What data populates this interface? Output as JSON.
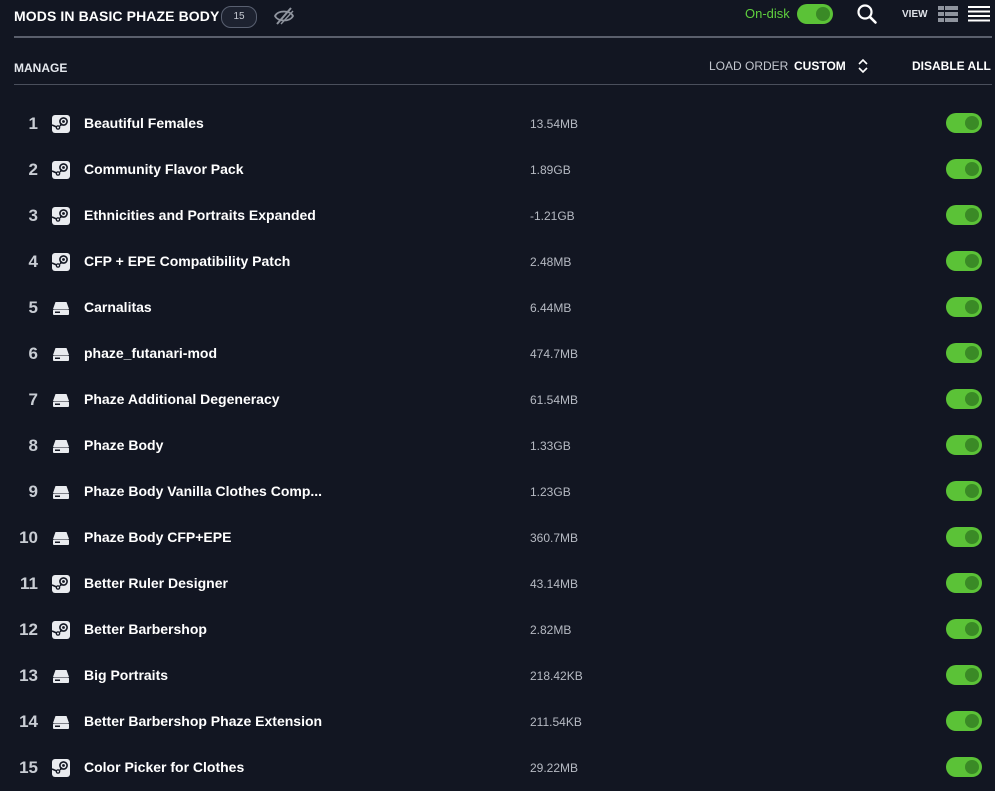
{
  "header": {
    "title": "MODS IN BASIC PHAZE BODY",
    "count": "15",
    "ondisk_label": "On-disk",
    "view_label": "VIEW"
  },
  "subheader": {
    "manage_label": "MANAGE",
    "load_order_label": "LOAD ORDER",
    "load_order_value": "CUSTOM",
    "disable_all_label": "DISABLE ALL"
  },
  "colors": {
    "background": "#121622",
    "toggle_on": "#5bc237",
    "ondisk_text": "#5fcf3e"
  },
  "mods": [
    {
      "num": "1",
      "name": "Beautiful Females",
      "size": "13.54MB",
      "source": "steam-icon",
      "enabled": true
    },
    {
      "num": "2",
      "name": "Community Flavor Pack",
      "size": "1.89GB",
      "source": "steam-icon",
      "enabled": true
    },
    {
      "num": "3",
      "name": "Ethnicities and Portraits Expanded",
      "size": "-1.21GB",
      "source": "steam-icon",
      "enabled": true
    },
    {
      "num": "4",
      "name": "CFP + EPE Compatibility Patch",
      "size": "2.48MB",
      "source": "steam-icon",
      "enabled": true
    },
    {
      "num": "5",
      "name": "Carnalitas",
      "size": "6.44MB",
      "source": "local-drive-icon",
      "enabled": true
    },
    {
      "num": "6",
      "name": "phaze_futanari-mod",
      "size": "474.7MB",
      "source": "local-drive-icon",
      "enabled": true
    },
    {
      "num": "7",
      "name": "Phaze Additional Degeneracy",
      "size": "61.54MB",
      "source": "local-drive-icon",
      "enabled": true
    },
    {
      "num": "8",
      "name": "Phaze Body",
      "size": "1.33GB",
      "source": "local-drive-icon",
      "enabled": true
    },
    {
      "num": "9",
      "name": "Phaze Body Vanilla Clothes Comp...",
      "size": "1.23GB",
      "source": "local-drive-icon",
      "enabled": true
    },
    {
      "num": "10",
      "name": "Phaze Body CFP+EPE",
      "size": "360.7MB",
      "source": "local-drive-icon",
      "enabled": true
    },
    {
      "num": "11",
      "name": "Better Ruler Designer",
      "size": "43.14MB",
      "source": "steam-icon",
      "enabled": true
    },
    {
      "num": "12",
      "name": "Better Barbershop",
      "size": "2.82MB",
      "source": "steam-icon",
      "enabled": true
    },
    {
      "num": "13",
      "name": "Big Portraits",
      "size": "218.42KB",
      "source": "local-drive-icon",
      "enabled": true
    },
    {
      "num": "14",
      "name": "Better Barbershop Phaze Extension",
      "size": "211.54KB",
      "source": "local-drive-icon",
      "enabled": true
    },
    {
      "num": "15",
      "name": "Color Picker for Clothes",
      "size": "29.22MB",
      "source": "steam-icon",
      "enabled": true
    }
  ]
}
